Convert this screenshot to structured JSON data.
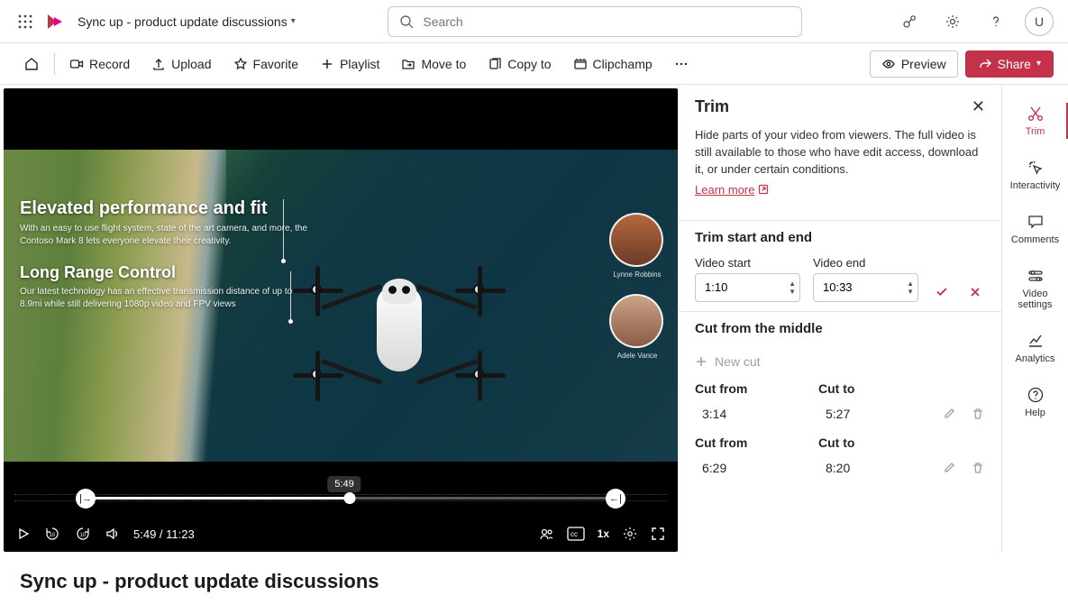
{
  "header": {
    "doc_title": "Sync up - product update discussions",
    "search_placeholder": "Search",
    "avatar_initial": "U"
  },
  "toolbar": {
    "record": "Record",
    "upload": "Upload",
    "favorite": "Favorite",
    "playlist": "Playlist",
    "moveto": "Move to",
    "copyto": "Copy to",
    "clipchamp": "Clipchamp",
    "preview": "Preview",
    "share": "Share"
  },
  "video": {
    "overlay_h1": "Elevated performance and fit",
    "overlay_p1": "With an easy to use flight system, state of the art camera, and more, the Contoso Mark 8 lets everyone elevate their creativity.",
    "overlay_h2": "Long Range Control",
    "overlay_p2": "Our latest technology has an effective transmission distance of up to 8.9mi while still delivering 1080p video and FPV views",
    "pip1_name": "Lynne Robbins",
    "pip2_name": "Adele Vance",
    "playhead_tip": "5:49",
    "time_display": "5:49 / 11:23",
    "speed": "1x"
  },
  "trim": {
    "title": "Trim",
    "desc": "Hide parts of your video from viewers. The full video is still available to those who have edit access, download it, or under certain conditions.",
    "learn": "Learn more",
    "section1": "Trim start and end",
    "start_label": "Video start",
    "end_label": "Video end",
    "start_value": "1:10",
    "end_value": "10:33",
    "section2": "Cut from the middle",
    "new_cut": "New cut",
    "cut_from_label": "Cut from",
    "cut_to_label": "Cut to",
    "cuts": [
      {
        "from": "3:14",
        "to": "5:27"
      },
      {
        "from": "6:29",
        "to": "8:20"
      }
    ]
  },
  "rail": {
    "trim": "Trim",
    "interactivity": "Interactivity",
    "comments": "Comments",
    "video_settings": "Video settings",
    "analytics": "Analytics",
    "help": "Help"
  },
  "page_title": "Sync up - product update discussions"
}
